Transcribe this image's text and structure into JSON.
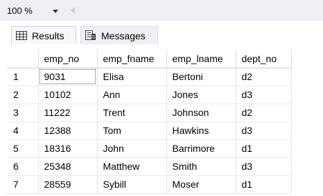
{
  "zoom": {
    "value": "100 %"
  },
  "tabs": [
    {
      "label": "Results",
      "icon": "grid-icon",
      "active": true
    },
    {
      "label": "Messages",
      "icon": "messages-icon",
      "active": false
    }
  ],
  "table": {
    "columns": [
      "",
      "emp_no",
      "emp_fname",
      "emp_lname",
      "dept_no"
    ],
    "rows": [
      [
        "1",
        "9031",
        "Elisa",
        "Bertoni",
        "d2"
      ],
      [
        "2",
        "10102",
        "Ann",
        "Jones",
        "d3"
      ],
      [
        "3",
        "11222",
        "Trent",
        "Johnson",
        "d2"
      ],
      [
        "4",
        "12388",
        "Tom",
        "Hawkins",
        "d3"
      ],
      [
        "5",
        "18316",
        "John",
        "Barrimore",
        "d1"
      ],
      [
        "6",
        "25348",
        "Matthew",
        "Smith",
        "d3"
      ],
      [
        "7",
        "28559",
        "Sybill",
        "Moser",
        "d1"
      ]
    ]
  },
  "colors": {
    "toolbar_bg": "#eef0f5",
    "grid_line": "#e3e3e3"
  }
}
